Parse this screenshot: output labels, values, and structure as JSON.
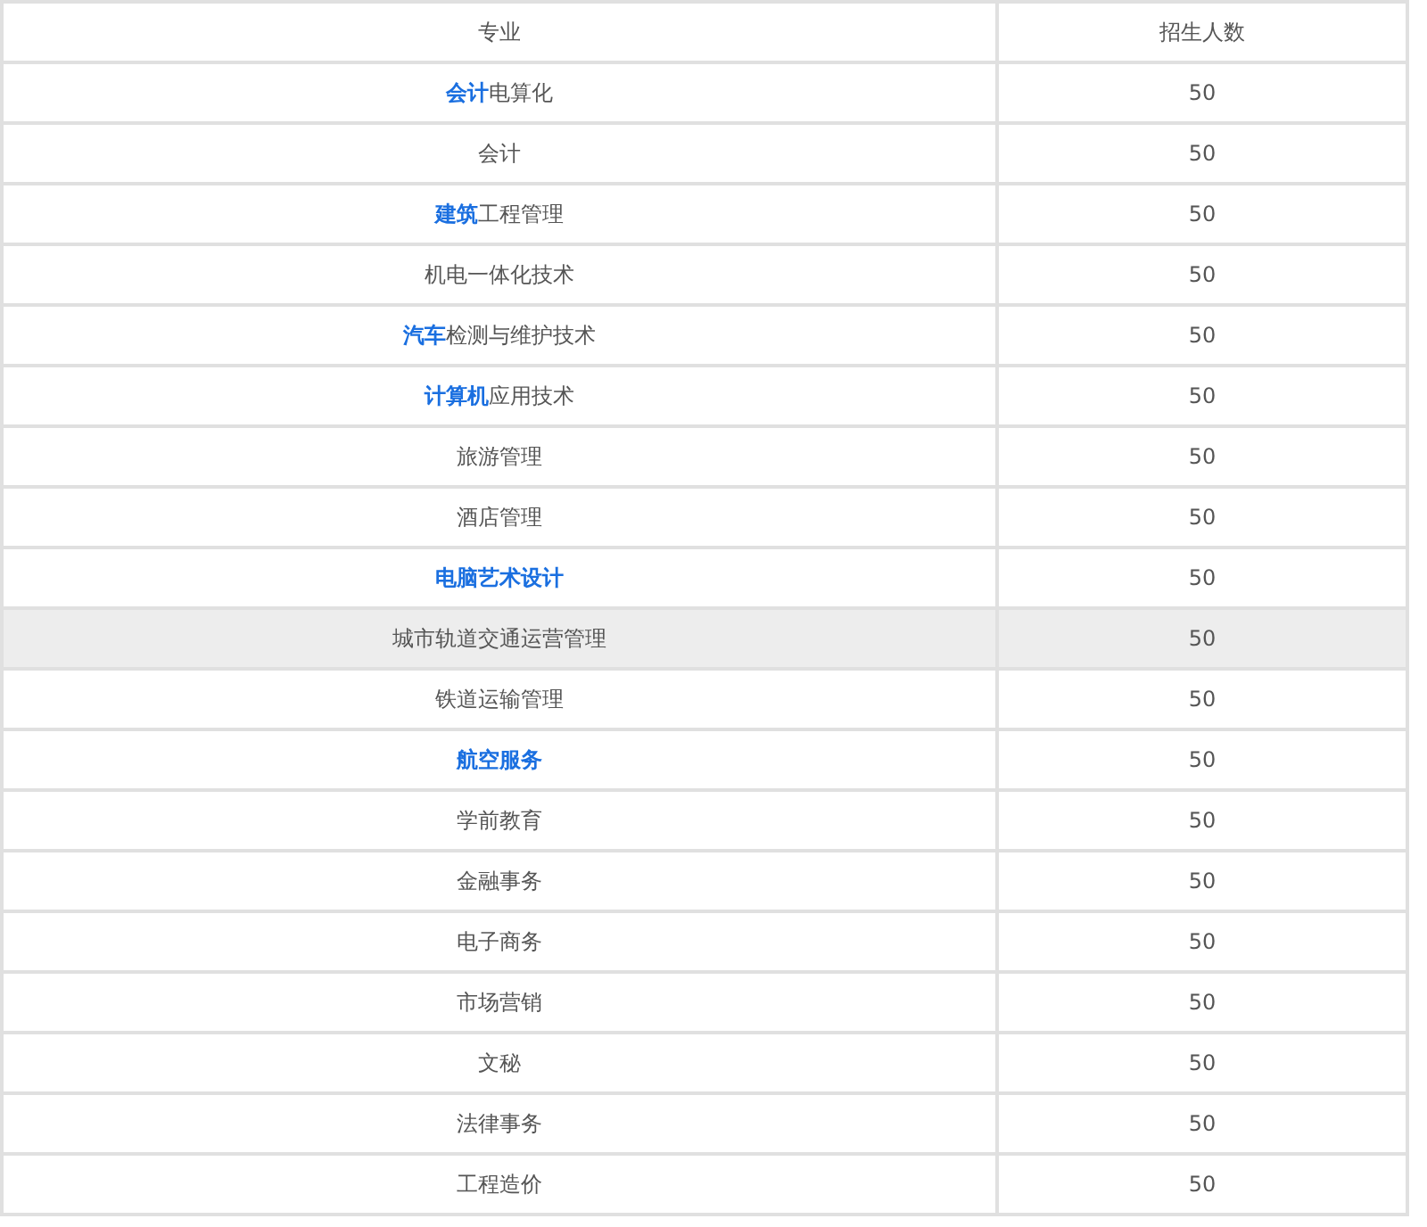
{
  "table": {
    "columns": [
      "专业",
      "招生人数"
    ],
    "rows": [
      {
        "link": "会计",
        "name": "电算化",
        "count": "50",
        "highlighted": false
      },
      {
        "name": "会计",
        "count": "50",
        "highlighted": false
      },
      {
        "link": "建筑",
        "name": "工程管理",
        "count": "50",
        "highlighted": false
      },
      {
        "name": "机电一体化技术",
        "count": "50",
        "highlighted": false
      },
      {
        "link": "汽车",
        "name": "检测与维护技术",
        "count": "50",
        "highlighted": false
      },
      {
        "link": "计算机",
        "name": "应用技术",
        "count": "50",
        "highlighted": false
      },
      {
        "name": "旅游管理",
        "count": "50",
        "highlighted": false
      },
      {
        "name": "酒店管理",
        "count": "50",
        "highlighted": false
      },
      {
        "link": "电脑艺术设计",
        "count": "50",
        "highlighted": false
      },
      {
        "name": "城市轨道交通运营管理",
        "count": "50",
        "highlighted": true
      },
      {
        "name": "铁道运输管理",
        "count": "50",
        "highlighted": false
      },
      {
        "link": "航空服务",
        "count": "50",
        "highlighted": false
      },
      {
        "name": "学前教育",
        "count": "50",
        "highlighted": false
      },
      {
        "name": "金融事务",
        "count": "50",
        "highlighted": false
      },
      {
        "name": "电子商务",
        "count": "50",
        "highlighted": false
      },
      {
        "name": "市场营销",
        "count": "50",
        "highlighted": false
      },
      {
        "name": "文秘",
        "count": "50",
        "highlighted": false
      },
      {
        "name": "法律事务",
        "count": "50",
        "highlighted": false
      },
      {
        "name": "工程造价",
        "count": "50",
        "highlighted": false
      }
    ]
  }
}
